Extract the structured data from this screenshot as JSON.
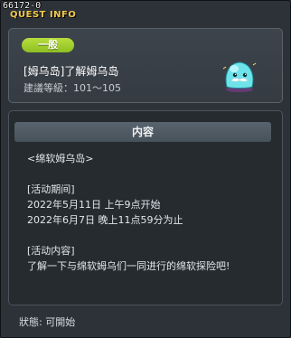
{
  "window": {
    "id_label": "66172-0",
    "title": "QUEST INFO"
  },
  "quest": {
    "badge": "一般",
    "name": "[姆乌岛]了解姆乌岛",
    "level_requirement": "建議等級：101～105",
    "icon": "slime-mob-icon"
  },
  "content": {
    "header": "内容",
    "location": "<绵软姆乌岛>",
    "period_heading": "[活动期间]",
    "period_start": "2022年5月11日 上午9点开始",
    "period_end": "2022年6月7日 晚上11点59分为止",
    "details_heading": "[活动内容]",
    "details_text": "了解一下与绵软姆乌们一同进行的绵软探险吧!"
  },
  "status": {
    "text": "狀態: 可開始"
  },
  "colors": {
    "title": "#f2c94c",
    "badge": "#a3cf2f",
    "panel": "#3d444c",
    "header": "#525c66"
  }
}
